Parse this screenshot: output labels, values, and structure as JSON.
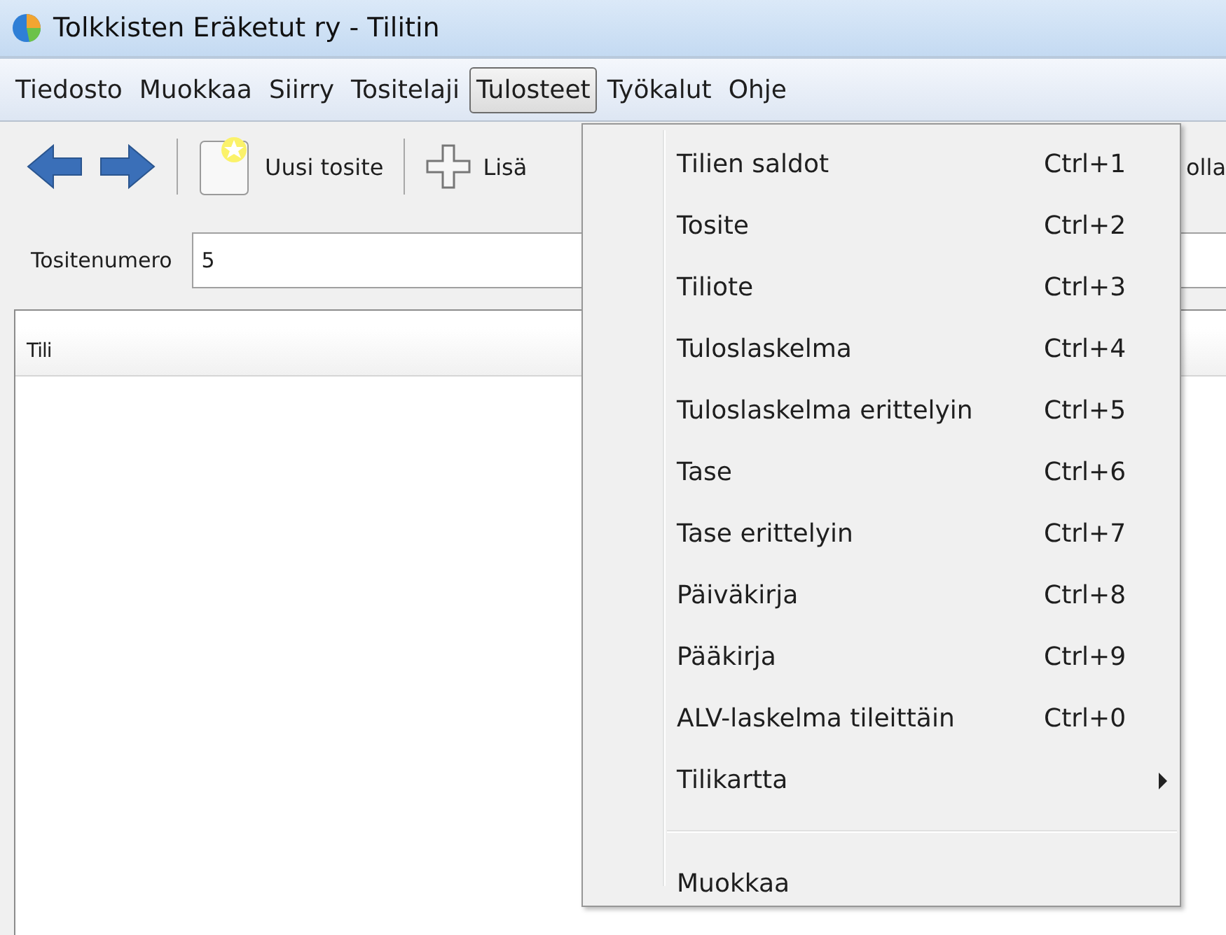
{
  "window": {
    "title": "Tolkkisten Eräketut ry - Tilitin"
  },
  "menubar": [
    {
      "label": "Tiedosto",
      "selected": false
    },
    {
      "label": "Muokkaa",
      "selected": false
    },
    {
      "label": "Siirry",
      "selected": false
    },
    {
      "label": "Tositelaji",
      "selected": false
    },
    {
      "label": "Tulosteet",
      "selected": true
    },
    {
      "label": "Työkalut",
      "selected": false
    },
    {
      "label": "Ohje",
      "selected": false
    }
  ],
  "toolbar": [
    {
      "kind": "back"
    },
    {
      "kind": "forward"
    },
    {
      "kind": "separator"
    },
    {
      "kind": "new",
      "label": "Uusi tosite"
    },
    {
      "kind": "separator"
    },
    {
      "kind": "add",
      "label": "Lisä"
    },
    {
      "kind": "text",
      "label": "olla"
    }
  ],
  "form": {
    "label": "Tositenumero",
    "value": "5"
  },
  "table": {
    "columns": [
      "Tili"
    ]
  },
  "menu": {
    "items": [
      {
        "kind": "item",
        "label": "Tilien saldot",
        "shortcut": "Ctrl+1"
      },
      {
        "kind": "item",
        "label": "Tosite",
        "shortcut": "Ctrl+2"
      },
      {
        "kind": "item",
        "label": "Tiliote",
        "shortcut": "Ctrl+3"
      },
      {
        "kind": "item",
        "label": "Tuloslaskelma",
        "shortcut": "Ctrl+4"
      },
      {
        "kind": "item",
        "label": "Tuloslaskelma erittelyin",
        "shortcut": "Ctrl+5"
      },
      {
        "kind": "item",
        "label": "Tase",
        "shortcut": "Ctrl+6"
      },
      {
        "kind": "item",
        "label": "Tase erittelyin",
        "shortcut": "Ctrl+7"
      },
      {
        "kind": "item",
        "label": "Päiväkirja",
        "shortcut": "Ctrl+8"
      },
      {
        "kind": "item",
        "label": "Pääkirja",
        "shortcut": "Ctrl+9"
      },
      {
        "kind": "item",
        "label": "ALV-laskelma tileittäin",
        "shortcut": "Ctrl+0"
      },
      {
        "kind": "submenu",
        "label": "Tilikartta"
      },
      {
        "kind": "separator"
      },
      {
        "kind": "item",
        "label": "Muokkaa"
      }
    ]
  }
}
